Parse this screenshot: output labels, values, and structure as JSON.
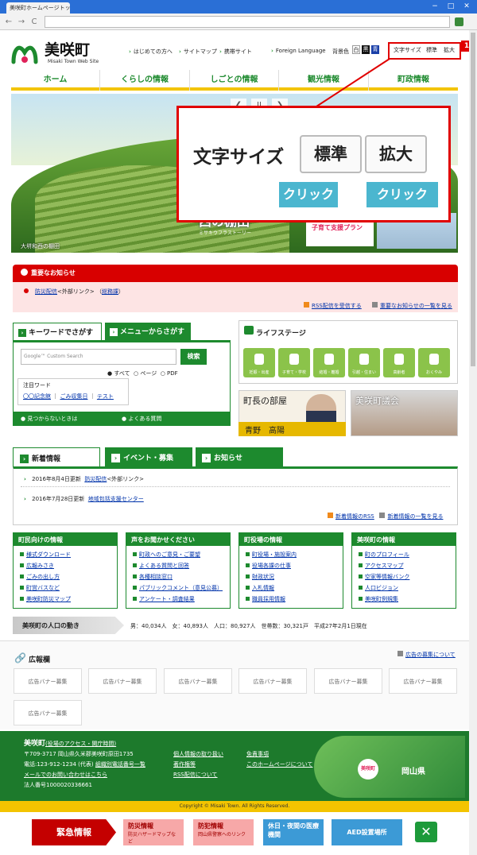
{
  "browser": {
    "tab_title": "美咲町ホームページトップペ",
    "address": "",
    "back": "←",
    "forward": "→",
    "reload": "C",
    "minimize": "−",
    "maximize": "□",
    "close": "✕"
  },
  "header": {
    "logo_title": "美咲町",
    "logo_sub": "Misaki Town Web Site",
    "links": [
      "はじめての方へ",
      "サイトマップ",
      "携帯サイト",
      "Foreign Language"
    ],
    "bg_label": "背景色",
    "bg_white": "白",
    "bg_black": "黒",
    "bg_blue": "青",
    "font_size_label": "文字サイズ",
    "font_standard": "標準",
    "font_large": "拡大",
    "badge": "1"
  },
  "nav": [
    "ホーム",
    "くらしの情報",
    "しごとの情報",
    "観光情報",
    "町政情報"
  ],
  "hero": {
    "caption": "大垪和西の棚田",
    "prev": "❮",
    "pause": "II",
    "next": "❯",
    "tanada": "西の棚田",
    "tanada_sub": "ミサキウフラストーリー",
    "banner": "子育て支援プラン"
  },
  "zoom": {
    "label": "文字サイズ",
    "standard": "標準",
    "large": "拡大",
    "click1": "クリック",
    "click2": "クリック"
  },
  "important": {
    "title": "重要なお知らせ",
    "item_link": "防災配信",
    "item_ext": "<外部リンク>",
    "item_dept_open": "（",
    "item_dept": "総務課",
    "item_dept_close": "）",
    "rss": "RSS配信を受信する",
    "list": "重要なお知らせの一覧を見る"
  },
  "search": {
    "tab_keyword": "キーワードでさがす",
    "tab_menu": "メニューからさがす",
    "placeholder": "Google™ Custom Search",
    "button": "検索",
    "radio_all": "すべて",
    "radio_page": "ページ",
    "radio_pdf": "PDF",
    "attention_title": "注目ワード",
    "attention_words": [
      "〇〇記念館",
      "ごみ収集日",
      "テスト"
    ],
    "foot_notfound": "見つからないときは",
    "foot_faq": "よくある質問"
  },
  "life": {
    "title": "ライフステージ",
    "items": [
      "妊娠・出産",
      "子育て・学校",
      "結婚・離婚",
      "引越・住まい",
      "高齢者",
      "おくやみ"
    ]
  },
  "mayor": {
    "title": "町長の部屋",
    "name": "青野　高陽"
  },
  "council": {
    "title": "美咲町議会"
  },
  "news": {
    "tab_new": "新着情報",
    "tab_event": "イベント・募集",
    "tab_notice": "お知らせ",
    "rows": [
      {
        "date": "2016年8月4日更新",
        "link": "防災配信",
        "ext": "<外部リンク>"
      },
      {
        "date": "2016年7月28日更新",
        "link": "地域包括支援センター",
        "ext": ""
      }
    ],
    "rss": "新着情報のRSS",
    "list": "新着情報の一覧を見る"
  },
  "columns": [
    {
      "title": "町民向けの情報",
      "items": [
        "様式ダウンロード",
        "広報みさき",
        "ごみの出し方",
        "町営バスなど",
        "美咲町防災マップ"
      ]
    },
    {
      "title": "声をお聞かせください",
      "items": [
        "町政へのご意見・ご要望",
        "よくある質問と回答",
        "各種相談窓口",
        "パブリックコメント（意見公募）",
        "アンケート・調査結果"
      ]
    },
    {
      "title": "町役場の情報",
      "items": [
        "町役場・施設案内",
        "役場各課の仕事",
        "財政状況",
        "入札情報",
        "職員採用情報"
      ]
    },
    {
      "title": "美咲町の情報",
      "items": [
        "町のプロフィール",
        "アクセスマップ",
        "空家等情報バンク",
        "人口ビジョン",
        "美咲町例規集"
      ]
    }
  ],
  "population": {
    "label": "美咲町の人口の動き",
    "text": "男：40,034人　女：40,893人　人口：80,927人　世帯数：30,321戸　平成27年2月1日現在"
  },
  "ads": {
    "title": "広報欄",
    "link": "広告の募集について",
    "banner": "広告バナー募集"
  },
  "footer": {
    "title": "美咲町",
    "title_link": "(役場のアクセス・開庁時間)",
    "address": "〒709-3717 岡山県久米郡美咲町原田1735",
    "phone": "電話:123-912-1234 (代表)",
    "phone_link": "組織別電話番号一覧",
    "mail": "メールでのお問い合わせはこちら",
    "corp": "法人番号1000020336661",
    "links": [
      "個人情報の取り扱い",
      "著作権等",
      "RSS配信について"
    ],
    "links2": [
      "免責事項",
      "このホームページについて"
    ],
    "map_town": "美咲町",
    "map_pref": "岡山県",
    "copyright": "Copyright © Misaki Town. All Rights Reserved."
  },
  "emergency": {
    "label": "緊急情報",
    "btn1": "防災情報",
    "btn1_sub": "防災ハザードマップなど",
    "btn2": "防犯情報",
    "btn2_sub": "岡山県警察へのリンク",
    "btn3": "休日・夜間の医療機関",
    "btn4": "AED設置場所",
    "close": "✕"
  }
}
